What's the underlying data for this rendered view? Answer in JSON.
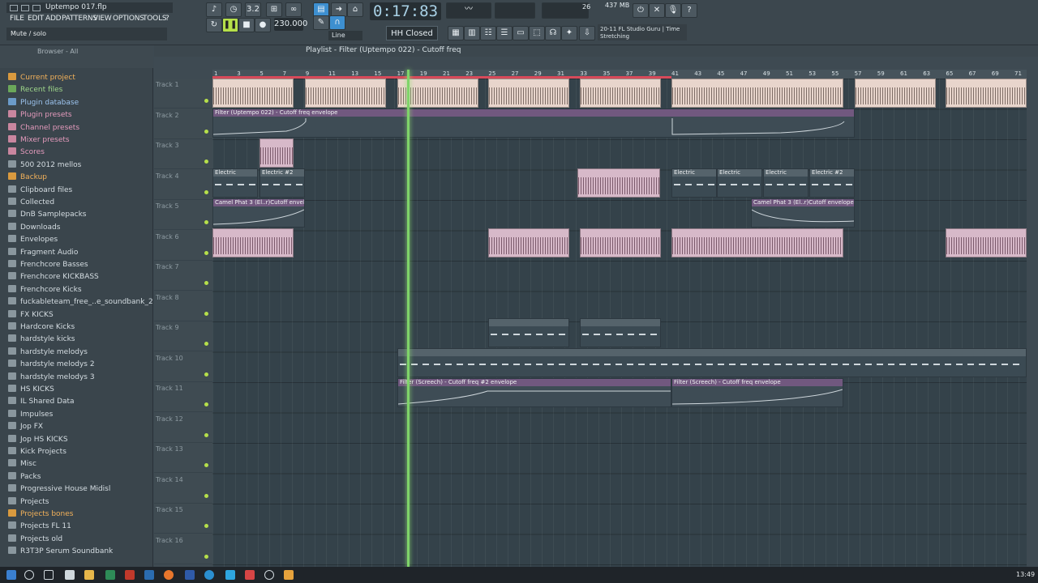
{
  "window": {
    "title": "Uptempo 017.flp"
  },
  "menu": [
    "FILE",
    "EDIT",
    "ADD",
    "PATTERNS",
    "VIEW",
    "OPTIONS",
    "TOOLS",
    "?"
  ],
  "hint_bar": "Mute / solo",
  "transport": {
    "time": "0:17:83",
    "tempo": "230.000",
    "snap": "Line",
    "pattern": "HH Closed",
    "memory": "437 MB",
    "cpu_voices": "26",
    "cpu_line2": "3"
  },
  "news": {
    "line1": "20-11  FL Studio Guru | Time",
    "line2": "Stretching"
  },
  "browser": {
    "title": "Browser - All",
    "items": [
      {
        "label": "Current project",
        "color": "orange"
      },
      {
        "label": "Recent files",
        "color": "green"
      },
      {
        "label": "Plugin database",
        "color": "blue"
      },
      {
        "label": "Plugin presets",
        "color": "pink"
      },
      {
        "label": "Channel presets",
        "color": "pink"
      },
      {
        "label": "Mixer presets",
        "color": "pink"
      },
      {
        "label": "Scores",
        "color": "pink"
      },
      {
        "label": "500 2012 mellos",
        "color": ""
      },
      {
        "label": "Backup",
        "color": "orange"
      },
      {
        "label": "Clipboard files",
        "color": ""
      },
      {
        "label": "Collected",
        "color": ""
      },
      {
        "label": "DnB Samplepacks",
        "color": ""
      },
      {
        "label": "Downloads",
        "color": ""
      },
      {
        "label": "Envelopes",
        "color": ""
      },
      {
        "label": "Fragment Audio",
        "color": ""
      },
      {
        "label": "Frenchcore Basses",
        "color": ""
      },
      {
        "label": "Frenchcore KICKBASS",
        "color": ""
      },
      {
        "label": "Frenchcore Kicks",
        "color": ""
      },
      {
        "label": "fuckableteam_free_..e_soundbank_2013_b",
        "color": ""
      },
      {
        "label": "FX KICKS",
        "color": ""
      },
      {
        "label": "Hardcore Kicks",
        "color": ""
      },
      {
        "label": "hardstyle kicks",
        "color": ""
      },
      {
        "label": "hardstyle melodys",
        "color": ""
      },
      {
        "label": "hardstyle melodys 2",
        "color": ""
      },
      {
        "label": "hardstyle melodys 3",
        "color": ""
      },
      {
        "label": "HS KICKS",
        "color": ""
      },
      {
        "label": "IL Shared Data",
        "color": ""
      },
      {
        "label": "Impulses",
        "color": ""
      },
      {
        "label": "Jop FX",
        "color": ""
      },
      {
        "label": "Jop HS KICKS",
        "color": ""
      },
      {
        "label": "Kick Projects",
        "color": ""
      },
      {
        "label": "Misc",
        "color": ""
      },
      {
        "label": "Packs",
        "color": ""
      },
      {
        "label": "Progressive House Midisl",
        "color": ""
      },
      {
        "label": "Projects",
        "color": ""
      },
      {
        "label": "Projects bones",
        "color": "orange"
      },
      {
        "label": "Projects FL 11",
        "color": ""
      },
      {
        "label": "Projects old",
        "color": ""
      },
      {
        "label": "R3T3P Serum Soundbank",
        "color": ""
      }
    ]
  },
  "playlist": {
    "title": "Playlist - Filter (Uptempo 022) - Cutoff freq",
    "ruler_ticks": [
      "1",
      "3",
      "5",
      "7",
      "9",
      "11",
      "13",
      "15",
      "17",
      "19",
      "21",
      "23",
      "25",
      "27",
      "29",
      "31",
      "33",
      "35",
      "37",
      "39",
      "41",
      "43",
      "45",
      "47",
      "49",
      "51",
      "53",
      "55",
      "57",
      "59",
      "61",
      "63",
      "65",
      "67",
      "69",
      "71"
    ],
    "tracks": [
      "Track 1",
      "Track 2",
      "Track 3",
      "Track 4",
      "Track 5",
      "Track 6",
      "Track 7",
      "Track 8",
      "Track 9",
      "Track 10",
      "Track 11",
      "Track 12",
      "Track 13",
      "Track 14",
      "Track 15",
      "Track 16"
    ],
    "clip_labels": {
      "filter_env": "Filter (Uptempo 022) - Cutoff freq envelope",
      "electric": "Electric",
      "electric2": "Electric #2",
      "camel": "Camel Phat 3 (El..r)Cutoff envelope",
      "screech": "Filter (Screech) - Cutoff freq #2 envelope",
      "screech2": "Filter (Screech) - Cutoff freq envelope"
    }
  },
  "taskbar": {
    "clock": "13:49"
  }
}
